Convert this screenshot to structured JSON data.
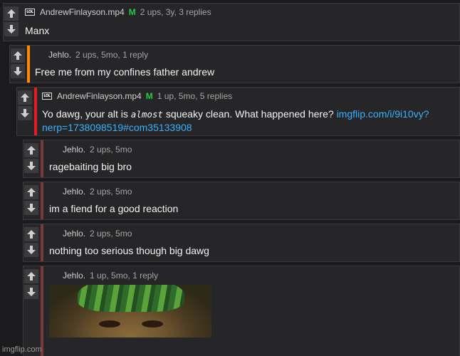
{
  "comments": [
    {
      "username": "AndrewFinlayson.mp4",
      "mod_badge": "M",
      "stats": "2 ups, 3y, 3 replies",
      "text": "Manx",
      "stripe_color": ""
    },
    {
      "username": "Jehlo.",
      "stats": "2 ups, 5mo, 1 reply",
      "text": "Free me from my confines father andrew",
      "stripe_color": "#ff8c00"
    },
    {
      "username": "AndrewFinlayson.mp4",
      "mod_badge": "M",
      "stats": "1 up, 5mo, 5 replies",
      "text_before": "Yo dawg, your alt is ",
      "text_emphasis": "almost",
      "text_after": " squeaky clean. What happened here? ",
      "link": "imgflip.com/i/9i10vy?nerp=1738098519#com35133908",
      "link_line1": "imgflip.com/i/9i10vy?",
      "link_line2": "nerp=1738098519#com35133908",
      "stripe_color": "#e02020"
    },
    {
      "username": "Jehlo.",
      "stats": "2 ups, 5mo",
      "text": "ragebaiting big bro",
      "stripe_color": "#7a3a3a"
    },
    {
      "username": "Jehlo.",
      "stats": "2 ups, 5mo",
      "text": "im a fiend for a good reaction",
      "stripe_color": "#7a3a3a"
    },
    {
      "username": "Jehlo.",
      "stats": "2 ups, 5mo",
      "text": "nothing too serious though big dawg",
      "stripe_color": "#7a3a3a"
    },
    {
      "username": "Jehlo.",
      "stats": "1 up, 5mo, 1 reply",
      "text": "",
      "stripe_color": "#7a3a3a"
    }
  ],
  "icons": {
    "upvote": "arrow-up-icon",
    "downvote": "arrow-down-icon",
    "lol_badge": "LOL"
  },
  "watermark": "imgflip.com",
  "colors": {
    "link": "#3ab0ff",
    "mod": "#22cc44"
  }
}
